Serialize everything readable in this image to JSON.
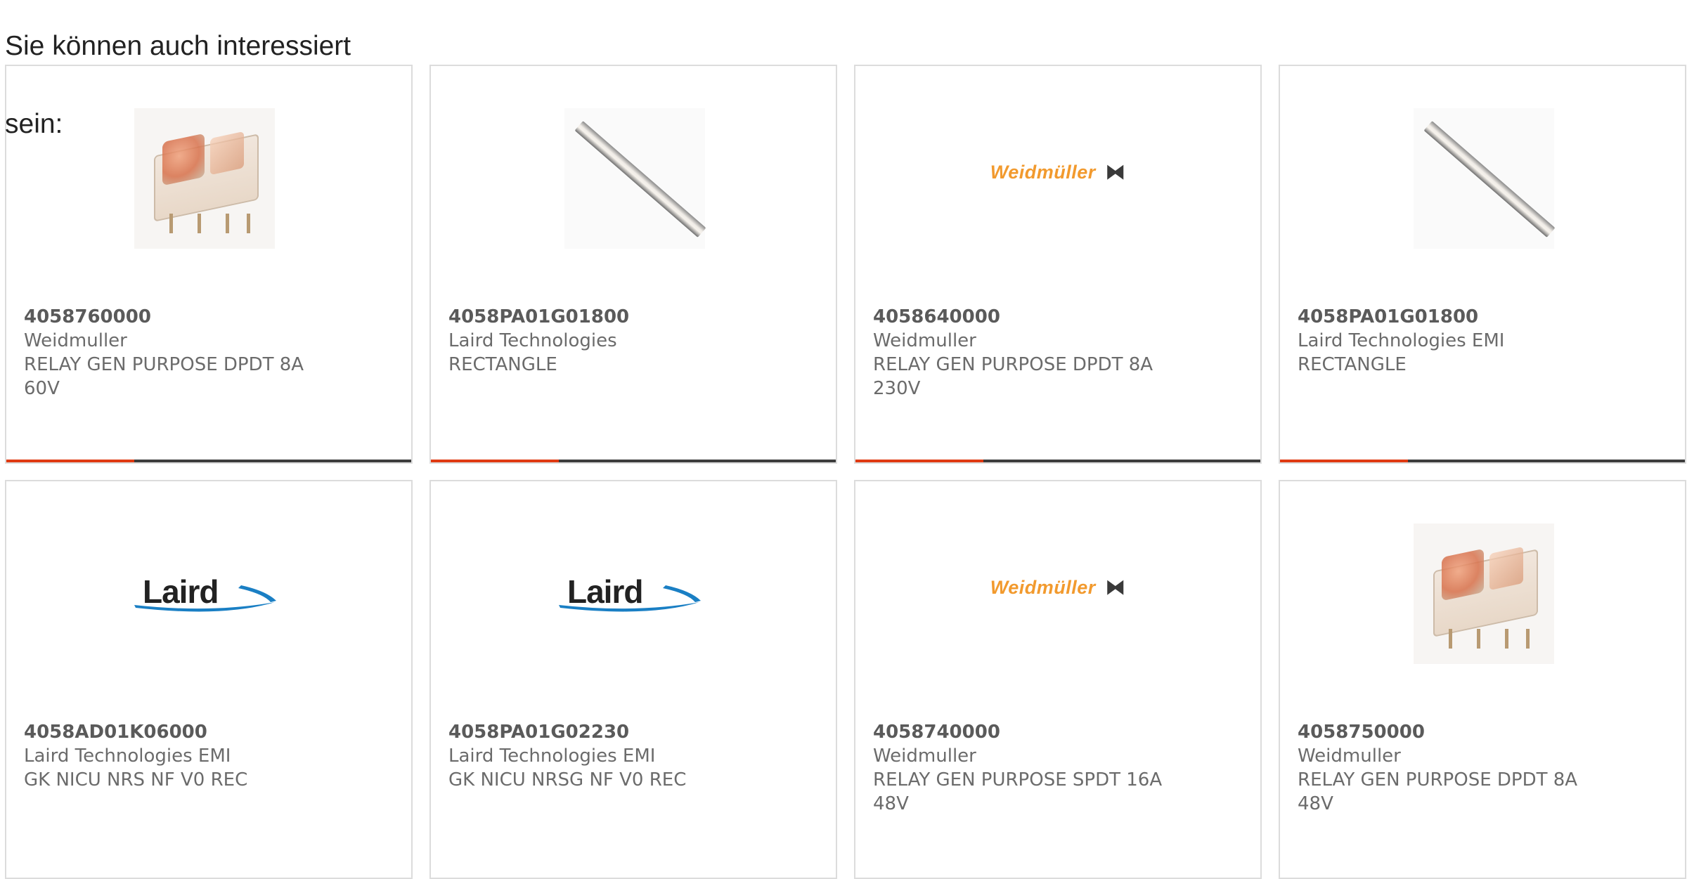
{
  "heading": "Sie können auch interessiert sein:",
  "products": [
    {
      "part_number": "4058760000",
      "manufacturer": "Weidmuller",
      "description": "RELAY GEN PURPOSE DPDT 8A 60V",
      "image": "relay-photo"
    },
    {
      "part_number": "4058PA01G01800",
      "manufacturer": "Laird Technologies",
      "description": "RECTANGLE",
      "image": "strip-photo"
    },
    {
      "part_number": "4058640000",
      "manufacturer": "Weidmuller",
      "description": "RELAY GEN PURPOSE DPDT 8A 230V",
      "image": "weidmuller-logo"
    },
    {
      "part_number": "4058PA01G01800",
      "manufacturer": "Laird Technologies EMI",
      "description": "RECTANGLE",
      "image": "strip-photo"
    },
    {
      "part_number": "4058AD01K06000",
      "manufacturer": "Laird Technologies EMI",
      "description": "GK NICU NRS NF V0 REC",
      "image": "laird-logo"
    },
    {
      "part_number": "4058PA01G02230",
      "manufacturer": "Laird Technologies EMI",
      "description": "GK NICU NRSG NF V0 REC",
      "image": "laird-logo"
    },
    {
      "part_number": "4058740000",
      "manufacturer": "Weidmuller",
      "description": "RELAY GEN PURPOSE SPDT 16A 48V",
      "image": "weidmuller-logo"
    },
    {
      "part_number": "4058750000",
      "manufacturer": "Weidmuller",
      "description": "RELAY GEN PURPOSE DPDT 8A 48V",
      "image": "relay-photo"
    }
  ],
  "logos": {
    "weidmuller": "Weidmüller",
    "weidmuller_mark": "⧓",
    "laird": "Laird"
  },
  "colors": {
    "accent": "#e03a12",
    "bar": "#3d3d3d",
    "card_border": "#dcdcdc",
    "weidmuller_orange": "#f29a2e",
    "laird_blue": "#1a7fc4"
  }
}
